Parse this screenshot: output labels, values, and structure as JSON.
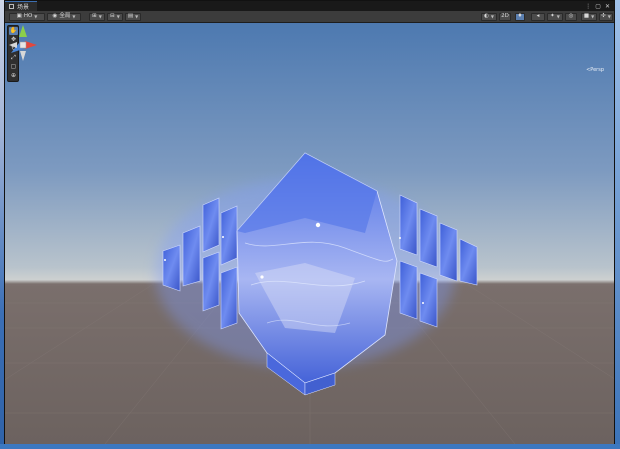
{
  "window": {
    "tab_title": "场景",
    "controls": [
      "⋮",
      "▢",
      "✕"
    ]
  },
  "toolbar": {
    "shading_mode": "HO",
    "global_toggle": "全局",
    "mode_2d": "2D"
  },
  "tools": [
    "hand",
    "move",
    "rotate",
    "scale",
    "rect",
    "transform"
  ],
  "gizmo": {
    "projection_label": "<Persp",
    "axis_colors": {
      "x": "#e2473c",
      "y": "#8ccf4a",
      "z": "#4a86d8"
    }
  },
  "colors": {
    "sky_top": "#4d79b0",
    "horizon": "#cdd0d0",
    "ground": "#6c625f",
    "panel_blue": "#4a6ee0",
    "selection_blue": "#5b7fb0"
  }
}
